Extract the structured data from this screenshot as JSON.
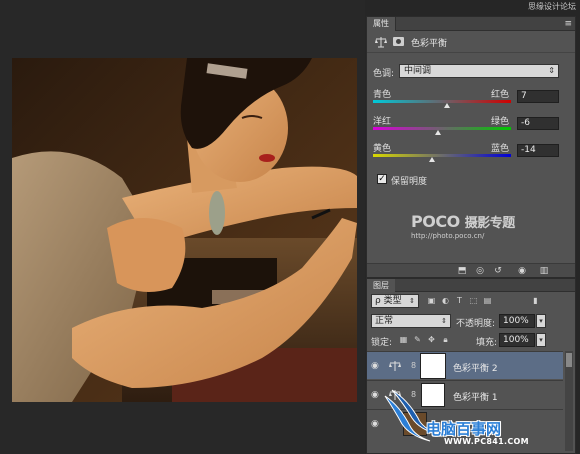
{
  "watermark_top": "思缘设计论坛",
  "properties_panel": {
    "tab_label": "属性",
    "menu_glyph": "≡",
    "title": "色彩平衡",
    "tone_label": "色调:",
    "tone_value": "中间调",
    "sliders": [
      {
        "left_label": "青色",
        "right_label": "红色",
        "value": "7",
        "fraction": 0.535,
        "gradient": [
          "#00c8d8",
          "#d00000"
        ]
      },
      {
        "left_label": "洋红",
        "right_label": "绿色",
        "value": "-6",
        "fraction": 0.47,
        "gradient": [
          "#d800d8",
          "#00c800"
        ]
      },
      {
        "left_label": "黄色",
        "right_label": "蓝色",
        "value": "-14",
        "fraction": 0.43,
        "gradient": [
          "#d8d800",
          "#0000d8"
        ]
      }
    ],
    "preserve_luminosity_label": "保留明度",
    "preserve_luminosity_checked": true,
    "poco_logo": "POCO",
    "poco_logo_suffix": "摄影专题",
    "poco_url": "http://photo.poco.cn/"
  },
  "layers_panel": {
    "tab_label": "图层",
    "filter_value": "ρ 类型",
    "blend_mode": "正常",
    "opacity_label": "不透明度:",
    "opacity_value": "100%",
    "lock_label": "锁定:",
    "fill_label": "填充:",
    "fill_value": "100%",
    "layers": [
      {
        "name": "色彩平衡 2",
        "selected": true
      },
      {
        "name": "色彩平衡 1",
        "selected": false
      }
    ]
  },
  "watermark_bottom": {
    "site": "电脑百事网",
    "url": "WWW.PC841.COM"
  },
  "colors": {
    "panel_bg": "#535353",
    "workspace_bg": "#282828",
    "selection": "#5c6d86",
    "watermark_blue": "#2c7fd6"
  }
}
